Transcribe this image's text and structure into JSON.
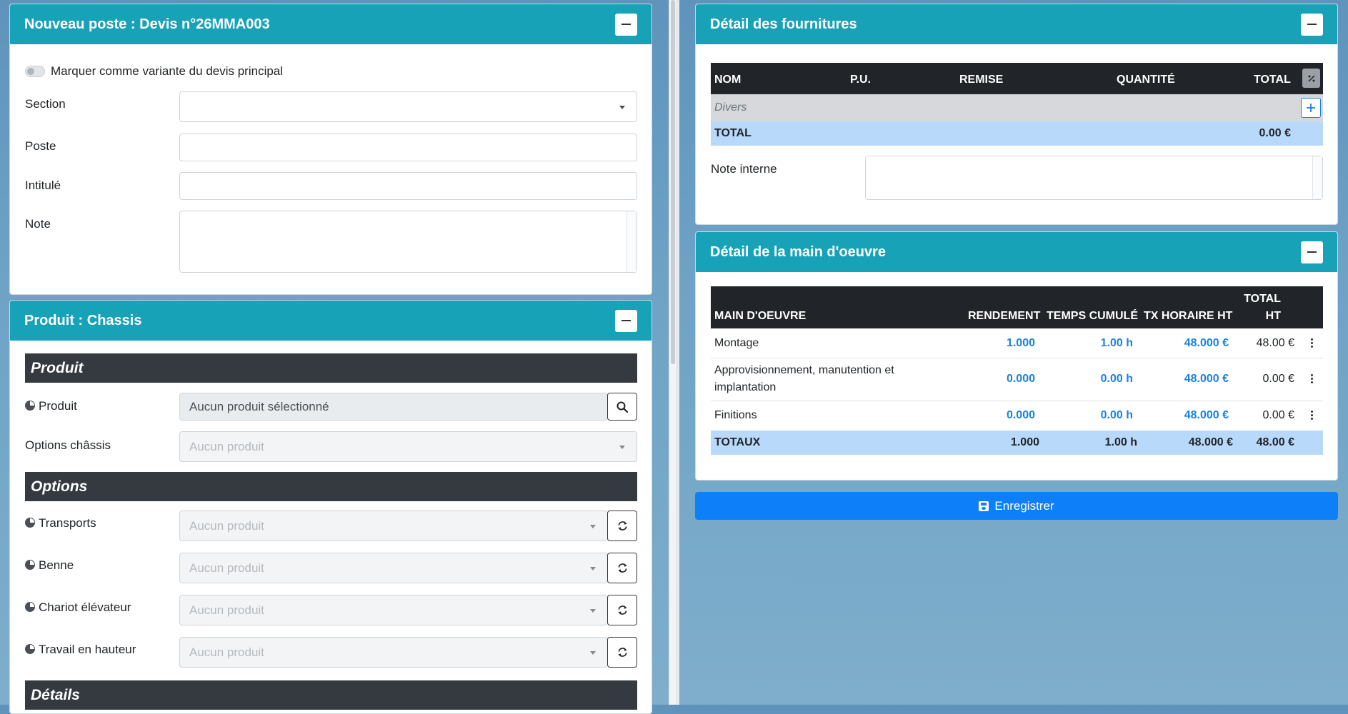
{
  "left_card1": {
    "title": "Nouveau poste : Devis n°26MMA003",
    "variant_label": "Marquer comme variante du devis principal",
    "section_label": "Section",
    "poste_label": "Poste",
    "intitule_label": "Intitulé",
    "note_label": "Note"
  },
  "left_card2": {
    "title": "Produit : Chassis",
    "section_produit": "Produit",
    "produit_label": "Produit",
    "produit_value": "Aucun produit sélectionné",
    "options_chassis_label": "Options châssis",
    "options_chassis_placeholder": "Aucun produit",
    "section_options": "Options",
    "options": [
      {
        "label": "Transports",
        "placeholder": "Aucun produit"
      },
      {
        "label": "Benne",
        "placeholder": "Aucun produit"
      },
      {
        "label": "Chariot élévateur",
        "placeholder": "Aucun produit"
      },
      {
        "label": "Travail en hauteur",
        "placeholder": "Aucun produit"
      }
    ],
    "section_details": "Détails"
  },
  "fournitures": {
    "title": "Détail des fournitures",
    "headers": {
      "nom": "NOM",
      "pu": "P.U.",
      "remise": "REMISE",
      "quantite": "QUANTITÉ",
      "total": "TOTAL"
    },
    "group_label": "Divers",
    "total_label": "TOTAL",
    "total_value": "0.00 €",
    "note_interne_label": "Note interne"
  },
  "main_oeuvre": {
    "title": "Détail de la main d'oeuvre",
    "headers": {
      "main": "MAIN D'OEUVRE",
      "rendement": "RENDEMENT",
      "temps": "TEMPS CUMULÉ",
      "tx": "TX HORAIRE HT",
      "total_line1": "TOTAL",
      "total_line2": "HT"
    },
    "rows": [
      {
        "name_line1": "Montage",
        "name_line2": "",
        "rendement": "1.000",
        "temps": "1.00 h",
        "tx": "48.000 €",
        "total": "48.00 €"
      },
      {
        "name_line1": "Approvisionnement, manutention et",
        "name_line2": "implantation",
        "rendement": "0.000",
        "temps": "0.00 h",
        "tx": "48.000 €",
        "total": "0.00 €"
      },
      {
        "name_line1": "Finitions",
        "name_line2": "",
        "rendement": "0.000",
        "temps": "0.00 h",
        "tx": "48.000 €",
        "total": "0.00 €"
      }
    ],
    "totals": {
      "label": "TOTAUX",
      "rendement": "1.000",
      "temps": "1.00 h",
      "tx": "48.000 €",
      "total": "48.00 €"
    }
  },
  "save_button": {
    "label": "Enregistrer"
  },
  "colors": {
    "header": "#17a2b8",
    "dark": "#343a40",
    "primary": "#0d7ff9",
    "link_blue": "#1a82e2",
    "total_row": "#b9d9fb",
    "group_row": "#d6d8db"
  }
}
